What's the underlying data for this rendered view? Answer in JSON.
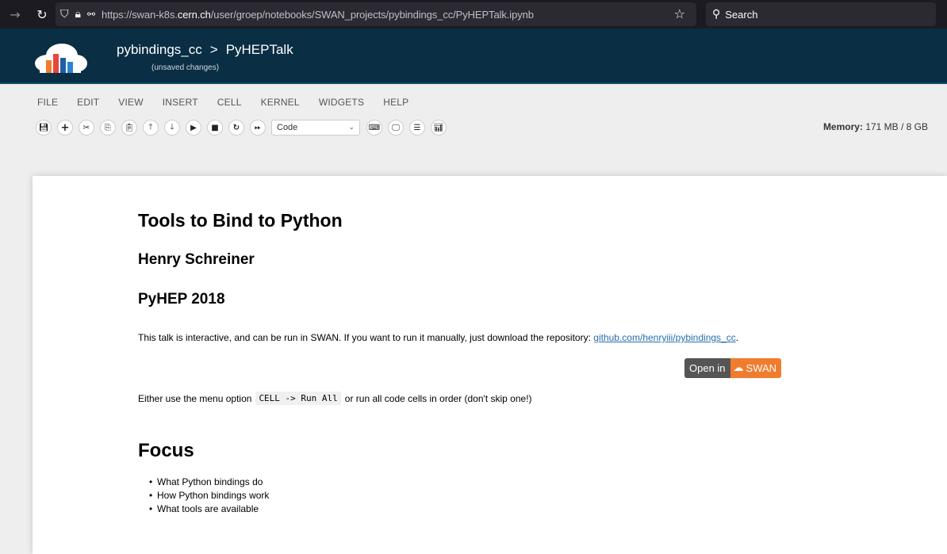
{
  "browser": {
    "url_prefix": "https://swan-k8s.",
    "url_domain": "cern.ch",
    "url_path": "/user/groep/notebooks/SWAN_projects/pybindings_cc/PyHEPTalk.ipynb",
    "search_placeholder": "Search"
  },
  "header": {
    "project": "pybindings_cc",
    "separator": ">",
    "notebook": "PyHEPTalk",
    "status": "(unsaved changes)"
  },
  "menu": [
    "FILE",
    "EDIT",
    "VIEW",
    "INSERT",
    "CELL",
    "KERNEL",
    "WIDGETS",
    "HELP"
  ],
  "toolbar": {
    "cell_type": "Code",
    "memory_label": "Memory:",
    "memory_value": "171 MB / 8 GB"
  },
  "notebook": {
    "title": "Tools to Bind to Python",
    "author": "Henry Schreiner",
    "event": "PyHEP 2018",
    "intro_text": "This talk is interactive, and can be run in SWAN. If you want to run it manually, just download the repository: ",
    "repo_link": "github.com/henryiii/pybindings_cc",
    "intro_end": ".",
    "badge_left": "Open in",
    "badge_right": "SWAN",
    "run_prefix": "Either use the menu option",
    "run_code": "CELL -> Run All",
    "run_suffix": "or run all code cells in order (don't skip one!)",
    "focus_heading": "Focus",
    "focus_items": [
      "What Python bindings do",
      "How Python bindings work",
      "What tools are available"
    ]
  },
  "colors": {
    "header_bg": "#0a2e44",
    "badge_orange": "#f07c2e",
    "link": "#296eaa"
  }
}
